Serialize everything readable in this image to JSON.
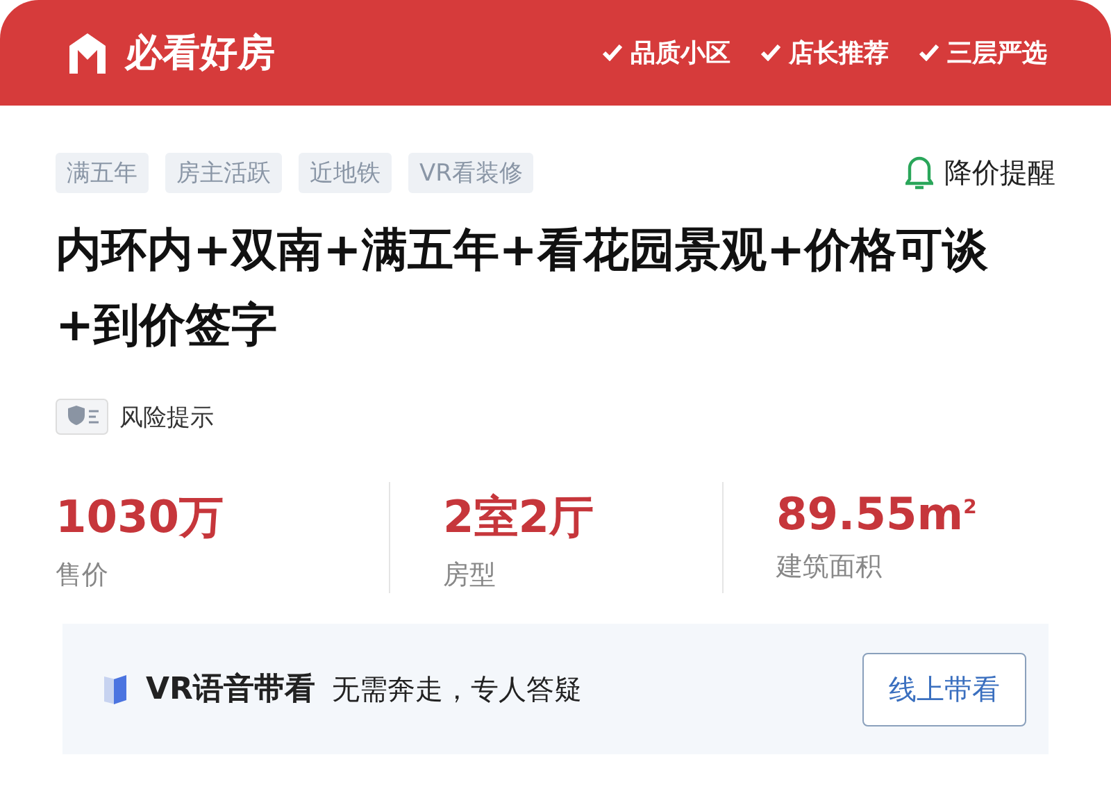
{
  "header": {
    "brand": "必看好房",
    "features": [
      "品质小区",
      "店长推荐",
      "三层严选"
    ]
  },
  "tags": [
    "满五年",
    "房主活跃",
    "近地铁",
    "VR看装修"
  ],
  "price_alert": "降价提醒",
  "title": "内环内+双南+满五年+看花园景观+价格可谈+到价签字",
  "risk": "风险提示",
  "stats": [
    {
      "value": "1030万",
      "label": "售价"
    },
    {
      "value": "2室2厅",
      "label": "房型"
    },
    {
      "value": "89.55m",
      "sup": "2",
      "label": "建筑面积"
    }
  ],
  "vr": {
    "title": "VR语音带看",
    "desc": "无需奔走，专人答疑",
    "button": "线上带看"
  }
}
